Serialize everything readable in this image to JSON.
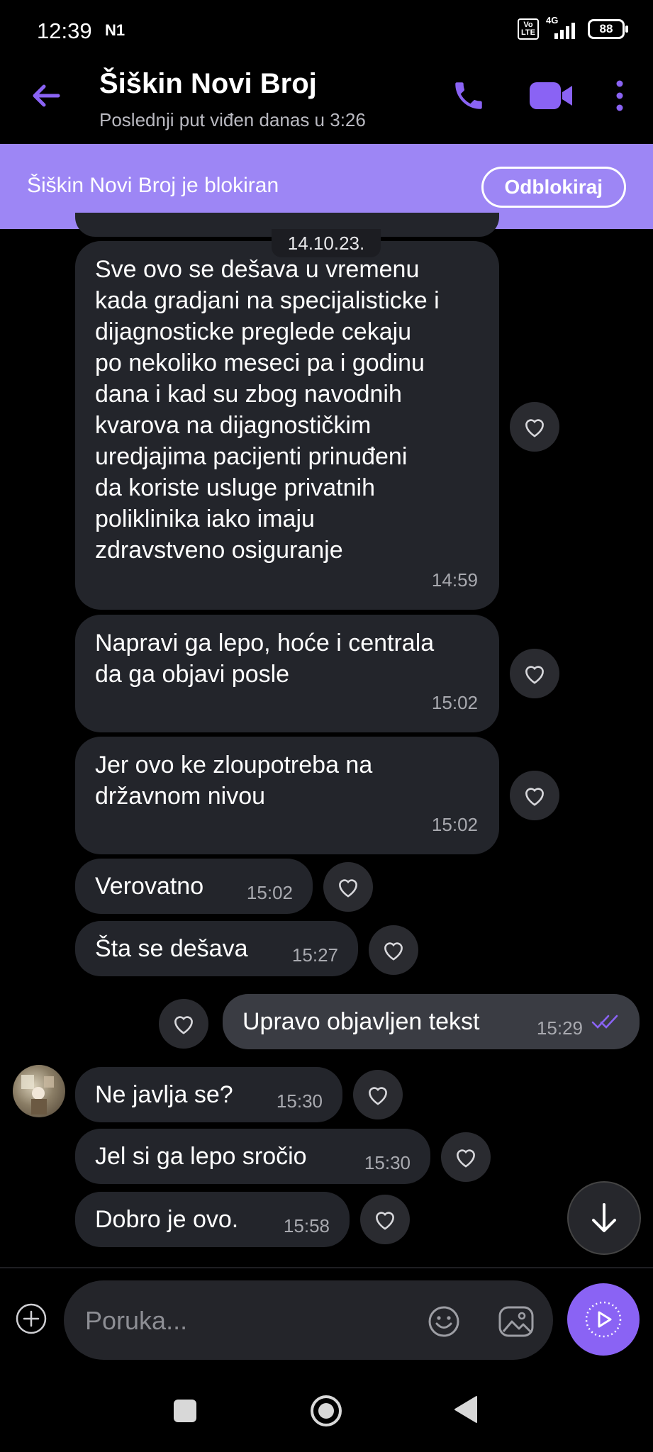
{
  "status_bar": {
    "time": "12:39",
    "network_badge": "N1",
    "volte_label": "Vo\nLTE",
    "signal_label": "4G",
    "battery": "88"
  },
  "header": {
    "contact_name": "Šiškin Novi Broj",
    "last_seen": "Poslednji put viđen danas u 3:26"
  },
  "banner": {
    "text": "Šiškin Novi Broj je blokiran",
    "unblock_label": "Odblokiraj"
  },
  "chat": {
    "date": "14.10.23.",
    "messages": [
      {
        "text": "Sve ovo se dešava u vremenu\nkada gradjani na specijalisticke i\ndijagnosticke preglede cekaju\npo nekoliko meseci pa i godinu\ndana i kad su zbog navodnih\nkvarova na dijagnostičkim\nuredjajima pacijenti prinuđeni\nda koriste usluge privatnih\npoliklinika iako imaju\nzdravstveno osiguranje",
        "time": "14:59"
      },
      {
        "text": "Napravi ga lepo, hoće i centrala\nda ga objavi posle",
        "time": "15:02"
      },
      {
        "text": "Jer ovo ke zloupotreba na\ndržavnom nivou",
        "time": "15:02"
      },
      {
        "text": "Verovatno",
        "time": "15:02"
      },
      {
        "text": "Šta se dešava",
        "time": "15:27"
      },
      {
        "text": "Upravo objavljen tekst",
        "time": "15:29",
        "outgoing": true
      },
      {
        "text": "Ne javlja se?",
        "time": "15:30"
      },
      {
        "text": "Jel si ga lepo sročio",
        "time": "15:30"
      },
      {
        "text": "Dobro je ovo.",
        "time": "15:58"
      }
    ]
  },
  "composer": {
    "placeholder": "Poruka..."
  },
  "colors": {
    "accent": "#8a63f4",
    "banner": "#9d86f5",
    "bubble_in": "#23252b",
    "bubble_out": "#3a3c43"
  }
}
